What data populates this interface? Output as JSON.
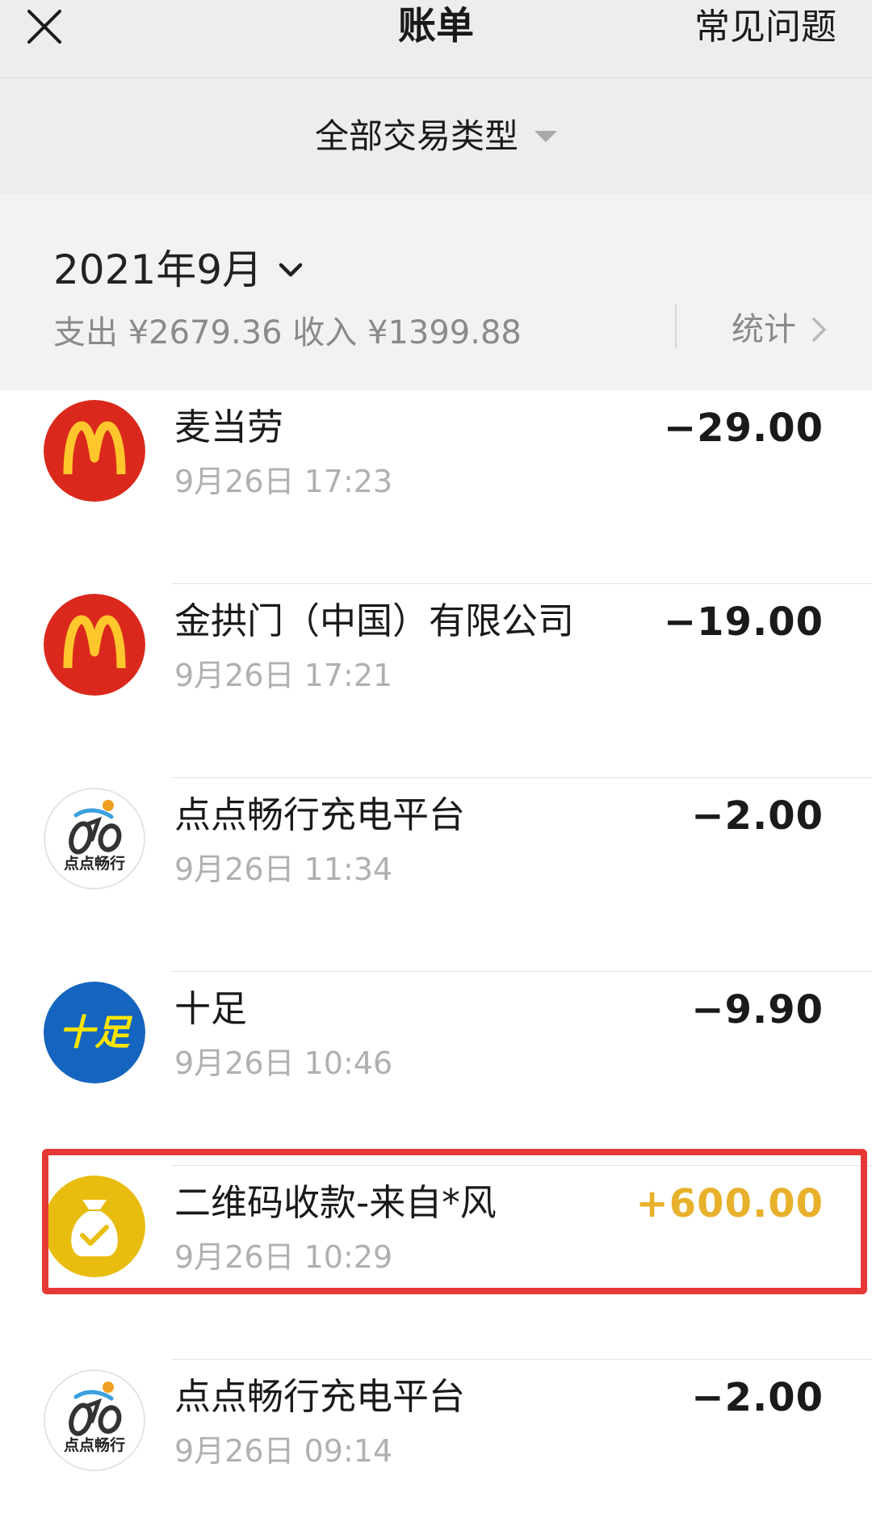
{
  "header": {
    "title": "账单",
    "faq": "常见问题"
  },
  "filter": {
    "label": "全部交易类型"
  },
  "month": {
    "label": "2021年9月",
    "summary": "支出 ¥2679.36 收入 ¥1399.88",
    "stats": "统计"
  },
  "transactions": [
    {
      "name": "麦当劳",
      "time": "9月26日 17:23",
      "amount": "−29.00",
      "type": "expense",
      "icon": "mcdonalds-logo-icon"
    },
    {
      "name": "金拱门（中国）有限公司",
      "time": "9月26日 17:21",
      "amount": "−19.00",
      "type": "expense",
      "icon": "mcdonalds-logo-icon"
    },
    {
      "name": "点点畅行充电平台",
      "time": "9月26日 11:34",
      "amount": "−2.00",
      "type": "expense",
      "icon": "diandian-logo-icon"
    },
    {
      "name": "十足",
      "time": "9月26日 10:46",
      "amount": "−9.90",
      "type": "expense",
      "icon": "shizu-logo-icon"
    },
    {
      "name": "二维码收款-来自*风",
      "time": "9月26日 10:29",
      "amount": "+600.00",
      "type": "income",
      "icon": "money-bag-icon"
    },
    {
      "name": "点点畅行充电平台",
      "time": "9月26日 09:14",
      "amount": "−2.00",
      "type": "expense",
      "icon": "diandian-logo-icon"
    }
  ],
  "icons": {
    "mcdonalds_logo_text": "M",
    "shizu_logo_text": "十足",
    "diandian_logo_text": "点点畅行"
  },
  "colors": {
    "mcdonalds_red": "#da291c",
    "mcdonalds_yellow": "#ffc72c",
    "shizu_blue": "#1565c0",
    "shizu_yellow": "#ffe600",
    "income_gold": "#e8b12c",
    "bag_yellow": "#e9bd10",
    "highlight_red": "#e53935"
  }
}
